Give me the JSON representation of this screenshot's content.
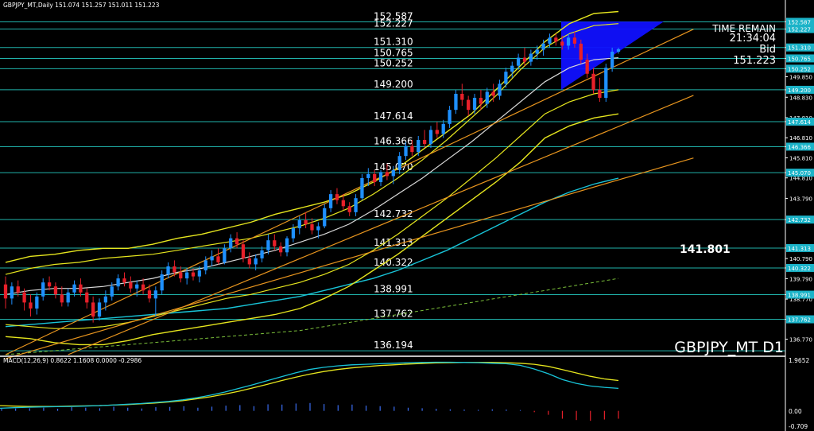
{
  "header": {
    "info": "GBPJPY_MT,Daily  151.074 151.257 151.011 151.223"
  },
  "symbol_label": "GBPJPY_MT D1",
  "big_level": "141.801",
  "info_box": {
    "time_label": "TIME REMAIN",
    "time_value": "21:34:04",
    "bid_label": "Bid",
    "bid_value": "151.223"
  },
  "macd": {
    "label": "MACD(12,26,9) 0.8622 1.1608 0.0000 -0.2986",
    "axis_top": "1.9652",
    "axis_zero": "0.00",
    "axis_bottom": "-0.709"
  },
  "colors": {
    "background": "#000000",
    "bull": "#1e90ff",
    "bear": "#e8202a",
    "level_line": "#20b2aa",
    "bollinger": "#e6e61e",
    "trend": "#e8951e",
    "ma_cyan": "#18c4d8",
    "ma_white": "#d8d8d8",
    "axis_tag": "#1bb3c8",
    "box": "#1010ff"
  },
  "chart_data": {
    "type": "candlestick",
    "title": "GBPJPY_MT D1",
    "ylim": [
      136.0,
      153.2
    ],
    "y_ticks": [
      "152.587",
      "152.227",
      "151.310",
      "150.765",
      "150.252",
      "149.850",
      "149.200",
      "148.830",
      "147.810",
      "147.614",
      "146.810",
      "146.366",
      "145.810",
      "145.070",
      "144.810",
      "143.790",
      "142.732",
      "141.313",
      "140.790",
      "140.322",
      "139.790",
      "138.991",
      "138.770",
      "137.762",
      "136.770"
    ],
    "levels": [
      152.587,
      152.227,
      151.31,
      150.765,
      150.252,
      149.2,
      147.614,
      146.366,
      145.07,
      142.732,
      141.313,
      140.322,
      138.991,
      137.762,
      136.194
    ],
    "level_labels": [
      "152.587",
      "152.227",
      "151.310",
      "150.765",
      "150.252",
      "149.200",
      "147.614",
      "146.366",
      "145.070",
      "142.732",
      "141.313",
      "140.322",
      "138.991",
      "137.762",
      "136.194"
    ],
    "level_tags": [
      "152.587",
      "152.227",
      "151.310",
      "150.765",
      "150.252",
      "149.200",
      "147.614",
      "146.366",
      "145.070",
      "142.732",
      "141.313",
      "140.322",
      "138.991",
      "137.762"
    ],
    "candles": [
      [
        139.5,
        139.9,
        138.3,
        138.8
      ],
      [
        138.8,
        139.6,
        138.5,
        139.4
      ],
      [
        139.4,
        139.7,
        138.9,
        139.1
      ],
      [
        139.1,
        139.3,
        138.2,
        138.6
      ],
      [
        138.6,
        139.0,
        137.9,
        138.3
      ],
      [
        138.3,
        139.1,
        138.0,
        138.9
      ],
      [
        138.9,
        139.8,
        138.7,
        139.6
      ],
      [
        139.6,
        139.9,
        139.2,
        139.4
      ],
      [
        139.4,
        139.6,
        138.8,
        139.0
      ],
      [
        139.0,
        139.4,
        138.4,
        138.6
      ],
      [
        138.6,
        139.3,
        138.4,
        139.1
      ],
      [
        139.1,
        139.7,
        138.9,
        139.5
      ],
      [
        139.5,
        139.8,
        138.9,
        139.1
      ],
      [
        139.1,
        139.3,
        138.3,
        138.6
      ],
      [
        138.6,
        138.9,
        137.6,
        137.9
      ],
      [
        137.9,
        138.8,
        137.7,
        138.6
      ],
      [
        138.6,
        139.2,
        138.2,
        138.9
      ],
      [
        138.9,
        139.6,
        138.7,
        139.4
      ],
      [
        139.4,
        140.0,
        139.2,
        139.8
      ],
      [
        139.8,
        140.1,
        139.4,
        139.6
      ],
      [
        139.6,
        139.9,
        139.1,
        139.3
      ],
      [
        139.3,
        139.7,
        138.9,
        139.5
      ],
      [
        139.5,
        139.8,
        139.0,
        139.2
      ],
      [
        139.2,
        139.5,
        138.6,
        138.8
      ],
      [
        138.8,
        139.4,
        137.9,
        139.2
      ],
      [
        139.2,
        140.2,
        139.0,
        140.0
      ],
      [
        140.0,
        140.6,
        139.8,
        140.4
      ],
      [
        140.4,
        140.7,
        139.9,
        140.1
      ],
      [
        140.1,
        140.4,
        139.6,
        139.8
      ],
      [
        139.8,
        140.3,
        139.5,
        140.1
      ],
      [
        140.1,
        140.3,
        139.7,
        139.9
      ],
      [
        139.9,
        140.4,
        139.6,
        140.2
      ],
      [
        140.2,
        140.9,
        140.0,
        140.7
      ],
      [
        140.7,
        141.2,
        140.4,
        140.9
      ],
      [
        140.9,
        141.3,
        140.5,
        140.6
      ],
      [
        140.6,
        141.5,
        140.5,
        141.3
      ],
      [
        141.3,
        142.0,
        141.1,
        141.8
      ],
      [
        141.8,
        142.1,
        141.3,
        141.5
      ],
      [
        141.5,
        141.7,
        140.6,
        140.8
      ],
      [
        140.8,
        141.1,
        140.3,
        140.5
      ],
      [
        140.5,
        141.0,
        140.2,
        140.8
      ],
      [
        140.8,
        141.4,
        140.6,
        141.2
      ],
      [
        141.2,
        142.0,
        141.0,
        141.7
      ],
      [
        141.7,
        142.0,
        141.2,
        141.4
      ],
      [
        141.4,
        141.6,
        140.9,
        141.1
      ],
      [
        141.1,
        141.9,
        140.9,
        141.8
      ],
      [
        141.8,
        142.5,
        141.6,
        142.3
      ],
      [
        142.3,
        142.9,
        142.0,
        142.7
      ],
      [
        142.7,
        143.1,
        142.3,
        142.5
      ],
      [
        142.5,
        142.8,
        142.0,
        142.2
      ],
      [
        142.2,
        142.6,
        141.8,
        142.4
      ],
      [
        142.4,
        143.5,
        142.3,
        143.3
      ],
      [
        143.3,
        144.2,
        143.1,
        144.0
      ],
      [
        144.0,
        144.3,
        143.5,
        143.7
      ],
      [
        143.7,
        144.0,
        143.2,
        143.4
      ],
      [
        143.4,
        143.6,
        142.9,
        143.1
      ],
      [
        143.1,
        144.0,
        142.9,
        143.8
      ],
      [
        143.8,
        145.0,
        143.7,
        144.8
      ],
      [
        144.8,
        145.3,
        144.4,
        145.0
      ],
      [
        145.0,
        145.2,
        144.4,
        144.6
      ],
      [
        144.6,
        145.2,
        144.4,
        145.1
      ],
      [
        145.1,
        145.5,
        144.7,
        144.9
      ],
      [
        144.9,
        145.4,
        144.5,
        145.2
      ],
      [
        145.2,
        146.1,
        145.0,
        145.9
      ],
      [
        145.9,
        146.6,
        145.7,
        146.4
      ],
      [
        146.4,
        146.7,
        145.9,
        146.1
      ],
      [
        146.1,
        146.9,
        145.9,
        146.7
      ],
      [
        146.7,
        147.2,
        146.3,
        146.5
      ],
      [
        146.5,
        147.4,
        146.3,
        147.2
      ],
      [
        147.2,
        147.6,
        146.8,
        147.0
      ],
      [
        147.0,
        147.7,
        146.8,
        147.5
      ],
      [
        147.5,
        148.4,
        147.3,
        148.2
      ],
      [
        148.2,
        149.2,
        148.0,
        149.0
      ],
      [
        149.0,
        149.5,
        148.4,
        148.7
      ],
      [
        148.7,
        148.9,
        147.9,
        148.2
      ],
      [
        148.2,
        149.0,
        148.0,
        148.8
      ],
      [
        148.8,
        149.2,
        148.2,
        148.5
      ],
      [
        148.5,
        149.3,
        148.3,
        149.1
      ],
      [
        149.1,
        149.5,
        148.6,
        148.9
      ],
      [
        148.9,
        149.7,
        148.7,
        149.5
      ],
      [
        149.5,
        150.3,
        149.3,
        150.1
      ],
      [
        150.1,
        150.6,
        149.8,
        150.4
      ],
      [
        150.4,
        151.0,
        150.2,
        150.8
      ],
      [
        150.8,
        151.3,
        150.4,
        150.6
      ],
      [
        150.6,
        151.2,
        150.4,
        151.0
      ],
      [
        151.0,
        151.4,
        150.7,
        151.2
      ],
      [
        151.2,
        151.7,
        150.9,
        151.5
      ],
      [
        151.5,
        152.0,
        151.3,
        151.8
      ],
      [
        151.8,
        152.0,
        151.4,
        151.6
      ],
      [
        151.6,
        151.9,
        151.2,
        151.4
      ],
      [
        151.4,
        152.0,
        151.2,
        151.8
      ],
      [
        151.8,
        152.1,
        151.3,
        151.5
      ],
      [
        151.5,
        151.7,
        150.5,
        150.7
      ],
      [
        150.7,
        151.0,
        149.8,
        150.0
      ],
      [
        150.0,
        150.3,
        149.0,
        149.2
      ],
      [
        149.2,
        149.8,
        148.6,
        148.8
      ],
      [
        148.8,
        150.5,
        148.6,
        150.3
      ],
      [
        150.3,
        151.3,
        150.1,
        151.1
      ],
      [
        151.1,
        151.3,
        151.0,
        151.223
      ]
    ],
    "bollinger_outer_upper": [
      140.6,
      140.9,
      141.0,
      141.2,
      141.3,
      141.3,
      141.5,
      141.8,
      142.0,
      142.3,
      142.6,
      143.0,
      143.3,
      143.6,
      144.0,
      144.6,
      145.3,
      146.2,
      147.1,
      148.0,
      149.2,
      150.4,
      151.6,
      152.5,
      153.0,
      153.1
    ],
    "bollinger_outer_lower": [
      136.9,
      136.8,
      136.6,
      136.5,
      136.5,
      136.7,
      137.0,
      137.2,
      137.4,
      137.6,
      137.8,
      138.0,
      138.3,
      138.8,
      139.4,
      140.2,
      141.0,
      141.9,
      142.8,
      143.7,
      144.6,
      145.6,
      146.8,
      147.4,
      147.8,
      148.0
    ],
    "bollinger_inner_upper": [
      140.0,
      140.3,
      140.5,
      140.6,
      140.8,
      140.9,
      141.0,
      141.2,
      141.4,
      141.6,
      141.8,
      142.1,
      142.4,
      142.8,
      143.3,
      144.0,
      144.8,
      145.7,
      146.7,
      147.8,
      148.9,
      150.2,
      151.3,
      152.0,
      152.4,
      152.5
    ],
    "bollinger_inner_lower": [
      137.5,
      137.4,
      137.3,
      137.3,
      137.4,
      137.6,
      137.9,
      138.2,
      138.5,
      138.8,
      139.0,
      139.3,
      139.6,
      140.0,
      140.5,
      141.2,
      142.0,
      142.9,
      143.8,
      144.8,
      145.8,
      146.9,
      148.0,
      148.6,
      149.0,
      149.2
    ],
    "ma_white": [
      139.0,
      139.2,
      139.3,
      139.3,
      139.4,
      139.6,
      139.8,
      140.1,
      140.3,
      140.6,
      140.9,
      141.2,
      141.6,
      142.0,
      142.5,
      143.2,
      144.0,
      144.8,
      145.7,
      146.6,
      147.6,
      148.6,
      149.6,
      150.3,
      150.7,
      150.8
    ],
    "ma_cyan": [
      137.4,
      137.5,
      137.6,
      137.7,
      137.8,
      137.9,
      138.0,
      138.1,
      138.2,
      138.3,
      138.5,
      138.7,
      138.9,
      139.2,
      139.5,
      139.8,
      140.2,
      140.7,
      141.2,
      141.8,
      142.4,
      143.0,
      143.6,
      144.1,
      144.5,
      144.8
    ],
    "ma_green_dashed": [
      136.0,
      136.1,
      136.2,
      136.3,
      136.4,
      136.5,
      136.6,
      136.7,
      136.8,
      136.9,
      137.0,
      137.1,
      137.2,
      137.4,
      137.6,
      137.8,
      138.0,
      138.2,
      138.4,
      138.6,
      138.8,
      139.0,
      139.2,
      139.4,
      139.6,
      139.8
    ],
    "trend_lines": [
      [
        [
          0,
          136.0
        ],
        [
          99,
          150.6
        ]
      ],
      [
        [
          0,
          135.8
        ],
        [
          99,
          144.8
        ]
      ],
      [
        [
          10,
          136.0
        ],
        [
          99,
          147.5
        ]
      ]
    ],
    "macd_line": [
      0.1,
      0.12,
      0.14,
      0.15,
      0.16,
      0.17,
      0.18,
      0.2,
      0.22,
      0.25,
      0.28,
      0.32,
      0.36,
      0.42,
      0.5,
      0.6,
      0.72,
      0.86,
      1.0,
      1.15,
      1.3,
      1.45,
      1.58,
      1.66,
      1.72,
      1.76,
      1.78,
      1.8,
      1.82,
      1.84,
      1.85,
      1.86,
      1.86,
      1.85,
      1.84,
      1.82,
      1.8,
      1.74,
      1.6,
      1.42,
      1.2,
      1.05,
      0.95,
      0.9,
      0.86
    ],
    "macd_signal": [
      0.2,
      0.18,
      0.17,
      0.17,
      0.17,
      0.18,
      0.19,
      0.2,
      0.22,
      0.24,
      0.27,
      0.3,
      0.34,
      0.39,
      0.46,
      0.54,
      0.64,
      0.75,
      0.88,
      1.01,
      1.15,
      1.28,
      1.4,
      1.5,
      1.58,
      1.64,
      1.69,
      1.73,
      1.76,
      1.79,
      1.81,
      1.83,
      1.84,
      1.85,
      1.85,
      1.85,
      1.84,
      1.82,
      1.78,
      1.7,
      1.58,
      1.45,
      1.32,
      1.22,
      1.16
    ],
    "macd_hist": [
      0.1,
      0.09,
      0.1,
      0.12,
      0.08,
      0.14,
      0.12,
      0.1,
      0.16,
      0.12,
      0.09,
      0.14,
      0.15,
      0.18,
      0.12,
      0.16,
      0.2,
      0.22,
      0.18,
      0.25,
      0.24,
      0.28,
      0.3,
      0.26,
      0.22,
      0.24,
      0.2,
      0.18,
      0.16,
      0.12,
      0.1,
      0.08,
      0.06,
      0.05,
      0.04,
      0.06,
      0.05,
      0.03,
      -0.05,
      -0.15,
      -0.3,
      -0.35,
      -0.38,
      -0.33,
      -0.3
    ]
  }
}
